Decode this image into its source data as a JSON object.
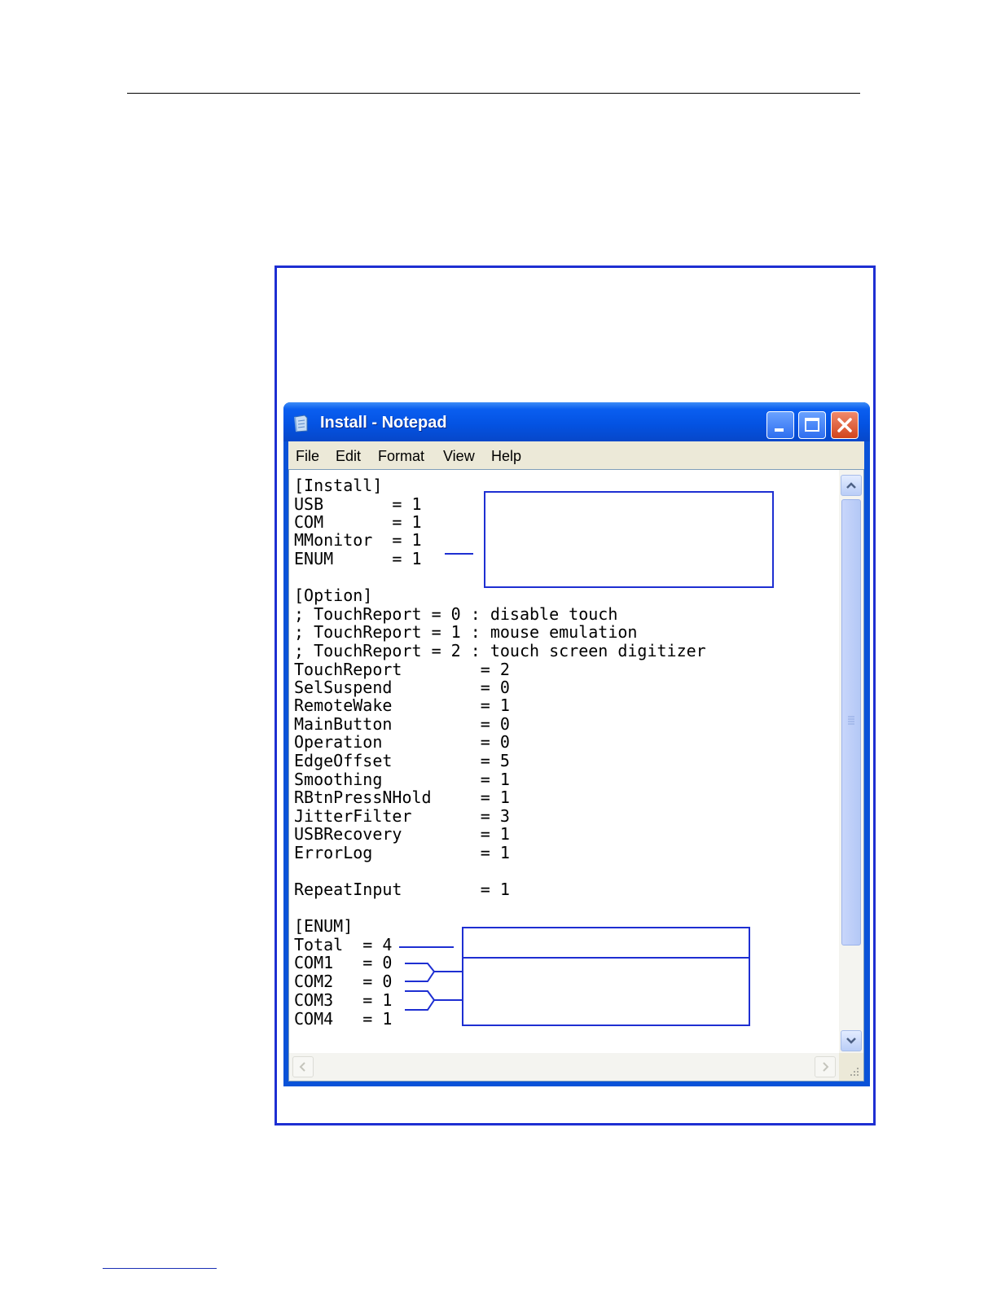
{
  "window": {
    "title": "Install - Notepad",
    "menu": [
      {
        "id": "file",
        "label": "File"
      },
      {
        "id": "edit",
        "label": "Edit"
      },
      {
        "id": "format",
        "label": "Format"
      },
      {
        "id": "view",
        "label": "View"
      },
      {
        "id": "help",
        "label": "Help"
      }
    ]
  },
  "file_content": {
    "lines": [
      "[Install]",
      "USB       = 1",
      "COM       = 1",
      "MMonitor  = 1",
      "ENUM      = 1",
      "",
      "[Option]",
      "; TouchReport = 0 : disable touch",
      "; TouchReport = 1 : mouse emulation",
      "; TouchReport = 2 : touch screen digitizer",
      "TouchReport        = 2",
      "SelSuspend         = 0",
      "RemoteWake         = 1",
      "MainButton         = 0",
      "Operation          = 0",
      "EdgeOffset         = 5",
      "Smoothing          = 1",
      "RBtnPressNHold     = 1",
      "JitterFilter       = 3",
      "USBRecovery        = 1",
      "ErrorLog           = 1",
      "",
      "RepeatInput        = 1",
      "",
      "[ENUM]",
      "Total  = 4",
      "COM1   = 0",
      "COM2   = 0",
      "COM3   = 1",
      "COM4   = 1"
    ]
  },
  "colors": {
    "accent": "#1e2fd2",
    "titlebar": "#0453e3",
    "menubar": "#ece9d8"
  },
  "icons": [
    "notepad-icon",
    "minimize-icon",
    "maximize-icon",
    "close-icon",
    "scroll-up-icon",
    "scroll-down-icon",
    "scroll-left-icon",
    "scroll-right-icon",
    "resize-grip-icon"
  ]
}
